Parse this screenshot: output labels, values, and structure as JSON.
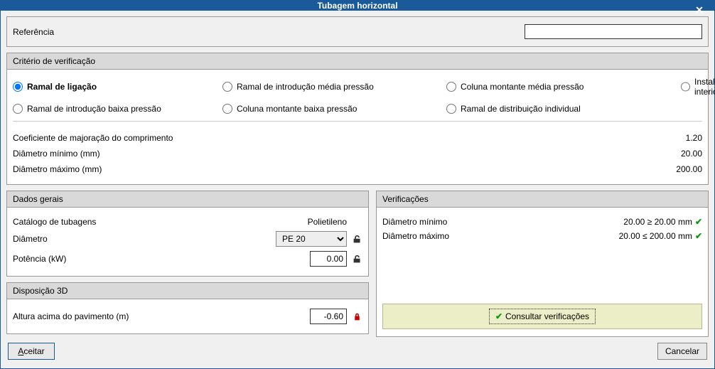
{
  "title": "Tubagem horizontal",
  "reference": {
    "label": "Referência",
    "value": ""
  },
  "criteria": {
    "header": "Critério de verificação",
    "options": {
      "ramal_ligacao": "Ramal de ligação",
      "ramal_intro_media": "Ramal de introdução média pressão",
      "coluna_media": "Coluna montante média pressão",
      "instalacao_interior": "Instalação interior",
      "ramal_intro_baixa": "Ramal de introdução baixa pressão",
      "coluna_baixa": "Coluna montante baixa pressão",
      "ramal_distrib": "Ramal de distribuição individual"
    },
    "coef_label": "Coeficiente de majoração do comprimento",
    "coef_value": "1.20",
    "dmin_label": "Diâmetro mínimo (mm)",
    "dmin_value": "20.00",
    "dmax_label": "Diâmetro máximo (mm)",
    "dmax_value": "200.00"
  },
  "dados": {
    "header": "Dados gerais",
    "catalogo_label": "Catálogo de tubagens",
    "catalogo_value": "Polietileno",
    "diametro_label": "Diâmetro",
    "diametro_value": "PE 20",
    "potencia_label": "Potência (kW)",
    "potencia_value": "0.00"
  },
  "disp3d": {
    "header": "Disposição 3D",
    "altura_label": "Altura acima do pavimento (m)",
    "altura_value": "-0.60"
  },
  "verif": {
    "header": "Verificações",
    "dmin_label": "Diâmetro mínimo",
    "dmin_text": "20.00 ≥ 20.00 mm",
    "dmax_label": "Diâmetro máximo",
    "dmax_text": "20.00 ≤ 200.00 mm",
    "consult": "Consultar verificações"
  },
  "buttons": {
    "accept": "Aceitar",
    "accept_u": "A",
    "cancel": "Cancelar"
  }
}
